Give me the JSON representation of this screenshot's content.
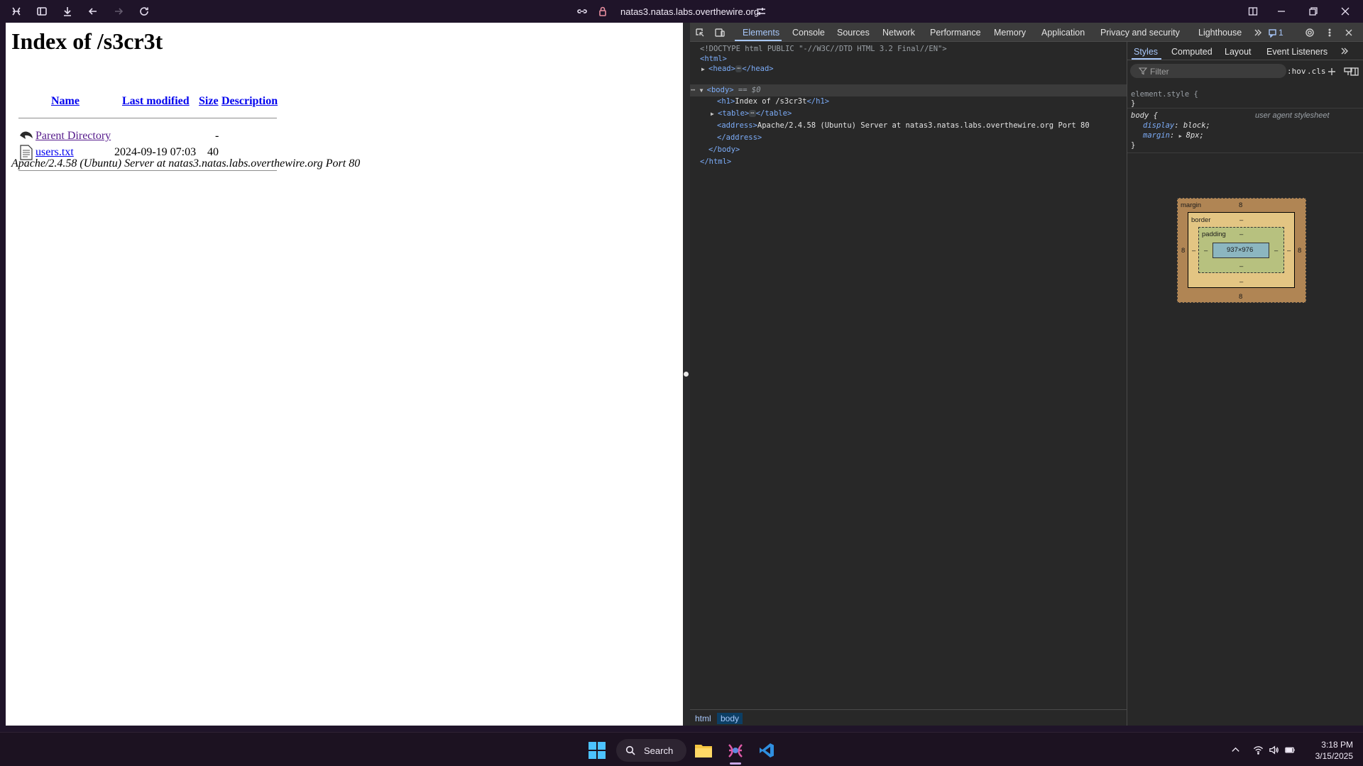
{
  "browser": {
    "url": "natas3.natas.labs.overthewire.org"
  },
  "page": {
    "heading": "Index of /s3cr3t",
    "columns": [
      "Name",
      "Last modified",
      "Size",
      "Description"
    ],
    "rows": [
      {
        "name": "Parent Directory",
        "modified": "",
        "size": "-",
        "description": ""
      },
      {
        "name": "users.txt",
        "modified": "2024-09-19 07:03",
        "size": "40",
        "description": ""
      }
    ],
    "address": "Apache/2.4.58 (Ubuntu) Server at natas3.natas.labs.overthewire.org Port 80"
  },
  "devtools": {
    "tabs": [
      "Elements",
      "Console",
      "Sources",
      "Network",
      "Performance",
      "Memory",
      "Application",
      "Privacy and security",
      "Lighthouse"
    ],
    "issues_count": "1",
    "dom": {
      "doctype": "<!DOCTYPE html PUBLIC \"-//W3C//DTD HTML 3.2 Final//EN\">",
      "html_open": "<html>",
      "head_open": "<head>",
      "head_close": "</head>",
      "body_open": "<body>",
      "selected_marker": "== $0",
      "h1_open": "<h1>",
      "h1_text": "Index of /s3cr3t",
      "h1_close": "</h1>",
      "table_open": "<table>",
      "table_close": "</table>",
      "address_open": "<address>",
      "address_text": "Apache/2.4.58 (Ubuntu) Server at natas3.natas.labs.overthewire.org Port 80",
      "address_close": "</address>",
      "body_close": "</body>",
      "html_close": "</html>",
      "ellipsis": "⋯",
      "row_dots": "⋯"
    },
    "breadcrumb": [
      "html",
      "body"
    ],
    "styles_tabs": [
      "Styles",
      "Computed",
      "Layout",
      "Event Listeners"
    ],
    "filter_placeholder": "Filter",
    "hov": ":hov",
    "cls": ".cls",
    "rules": {
      "element_style": "element.style {",
      "close_brace": "}",
      "body_selector": "body {",
      "ua_label": "user agent stylesheet",
      "prop1": "display",
      "val1": "block;",
      "prop2": "margin",
      "val2": "8px;"
    },
    "box_model": {
      "margin_label": "margin",
      "border_label": "border",
      "padding_label": "padding",
      "margin_value": "8",
      "dash": "–",
      "content_size": "937×976"
    }
  },
  "taskbar": {
    "search_label": "Search",
    "time": "3:18 PM",
    "date": "3/15/2025"
  }
}
